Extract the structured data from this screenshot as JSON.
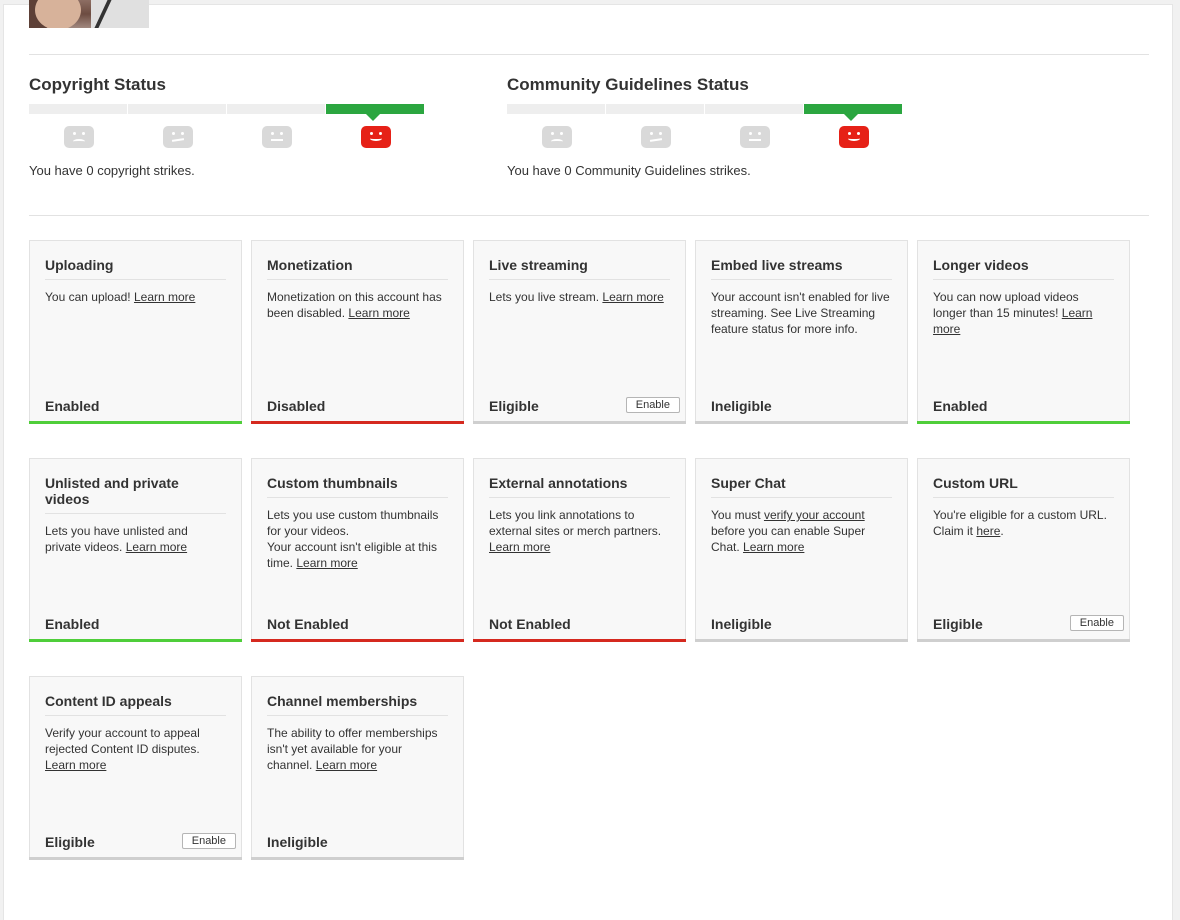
{
  "copyright": {
    "title": "Copyright Status",
    "message": "You have 0 copyright strikes."
  },
  "community": {
    "title": "Community Guidelines Status",
    "message": "You have 0 Community Guidelines strikes."
  },
  "colors": {
    "enabled": "#4fce3a",
    "disabled": "#d5291f",
    "neutral": "#cfcfcf",
    "strike_active": "#2ba640",
    "face_red": "#e62117"
  },
  "features": [
    {
      "title": "Uploading",
      "desc": "You can upload!",
      "link": "Learn more",
      "state": "Enabled",
      "status": "green"
    },
    {
      "title": "Monetization",
      "desc": "Monetization on this account has been disabled.",
      "link": "Learn more",
      "state": "Disabled",
      "status": "red"
    },
    {
      "title": "Live streaming",
      "desc": "Lets you live stream.",
      "link": "Learn more",
      "state": "Eligible",
      "status": "neutral",
      "button": "Enable"
    },
    {
      "title": "Embed live streams",
      "desc": "Your account isn't enabled for live streaming. See Live Streaming feature status for more info.",
      "state": "Ineligible",
      "status": "neutral"
    },
    {
      "title": "Longer videos",
      "desc": "You can now upload videos longer than 15 minutes!",
      "link": "Learn more",
      "state": "Enabled",
      "status": "green"
    },
    {
      "title": "Unlisted and private videos",
      "desc": "Lets you have unlisted and private videos.",
      "link": "Learn more",
      "state": "Enabled",
      "status": "green"
    },
    {
      "title": "Custom thumbnails",
      "desc": "Lets you use custom thumbnails for your videos.",
      "desc2": "Your account isn't eligible at this time.",
      "link": "Learn more",
      "state": "Not Enabled",
      "status": "red"
    },
    {
      "title": "External annotations",
      "desc": "Lets you link annotations to external sites or merch partners.",
      "link": "Learn more",
      "state": "Not Enabled",
      "status": "red"
    },
    {
      "title": "Super Chat",
      "desc_pre": "You must",
      "desc_link": "verify your account",
      "desc_post": "before you can enable Super Chat.",
      "link": "Learn more",
      "state": "Ineligible",
      "status": "neutral"
    },
    {
      "title": "Custom URL",
      "desc": "You're eligible for a custom URL. Claim it",
      "inline_link": "here",
      "state": "Eligible",
      "status": "neutral",
      "button": "Enable"
    },
    {
      "title": "Content ID appeals",
      "desc": "Verify your account to appeal rejected Content ID disputes.",
      "link": "Learn more",
      "state": "Eligible",
      "status": "neutral",
      "button": "Enable"
    },
    {
      "title": "Channel memberships",
      "desc": "The ability to offer memberships isn't yet available for your channel.",
      "link": "Learn more",
      "state": "Ineligible",
      "status": "neutral"
    }
  ]
}
